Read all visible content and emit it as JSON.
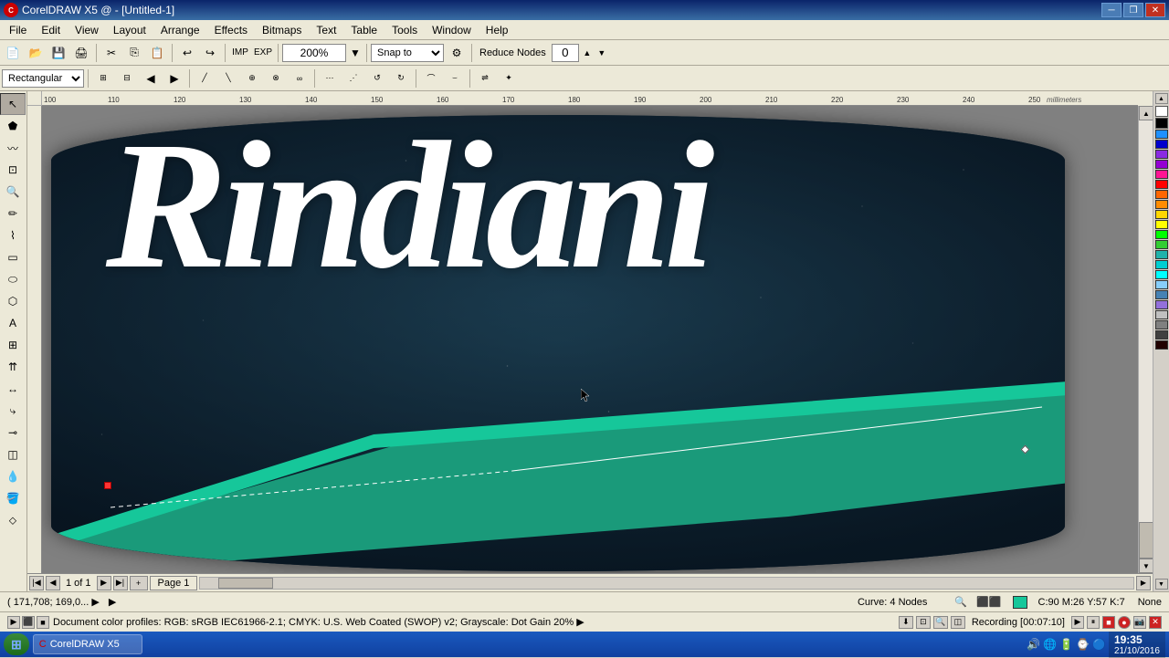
{
  "titlebar": {
    "title": "CorelDRAW X5 @ - [Untitled-1]",
    "logo": "C",
    "minimize_label": "─",
    "restore_label": "❐",
    "close_label": "✕",
    "app_min": "─",
    "app_max": "❐",
    "app_close": "✕"
  },
  "menubar": {
    "items": [
      {
        "label": "File",
        "id": "file"
      },
      {
        "label": "Edit",
        "id": "edit"
      },
      {
        "label": "View",
        "id": "view"
      },
      {
        "label": "Layout",
        "id": "layout"
      },
      {
        "label": "Arrange",
        "id": "arrange"
      },
      {
        "label": "Effects",
        "id": "effects"
      },
      {
        "label": "Bitmaps",
        "id": "bitmaps"
      },
      {
        "label": "Text",
        "id": "text"
      },
      {
        "label": "Table",
        "id": "table"
      },
      {
        "label": "Tools",
        "id": "tools"
      },
      {
        "label": "Window",
        "id": "window"
      },
      {
        "label": "Help",
        "id": "help"
      }
    ]
  },
  "toolbar": {
    "zoom_value": "200%",
    "snap_to": "Snap to",
    "reduce_nodes": "Reduce Nodes",
    "node_count": "0",
    "node_type_dropdown": "Rectangular"
  },
  "canvas": {
    "design_text": "Rindiani",
    "background_color": "#0d2030"
  },
  "statusbar": {
    "coordinates": "( 171,708; 169,0... ▶",
    "curve_info": "Curve: 4 Nodes",
    "color_info": "C:90 M:26 Y:57 K:7",
    "fill_none": "None"
  },
  "docinfo": {
    "color_profiles": "Document color profiles: RGB: sRGB IEC61966-2.1; CMYK: U.S. Web Coated (SWOP) v2; Grayscale: Dot Gain 20% ▶"
  },
  "pages": {
    "current": "1 of 1",
    "page_name": "Page 1"
  },
  "recording": {
    "label": "Recording [00:07:10]"
  },
  "taskbar": {
    "time": "19:35",
    "date": "21/10/2016"
  },
  "palette_colors": [
    "#FFFFFF",
    "#000000",
    "#FF0000",
    "#00FF00",
    "#0000FF",
    "#FFFF00",
    "#FF00FF",
    "#00FFFF",
    "#FF8000",
    "#8000FF",
    "#00FF80",
    "#FF0080",
    "#0080FF",
    "#80FF00",
    "#FF8080",
    "#8080FF",
    "#80FF80",
    "#FFFF80",
    "#808080",
    "#C0C0C0",
    "#400000",
    "#004000",
    "#000040",
    "#404000",
    "#400040",
    "#004040",
    "#804000",
    "#008040",
    "#000080",
    "#800040",
    "#2E8B57",
    "#20B2AA",
    "#1E90FF",
    "#FF6347",
    "#FFD700"
  ],
  "bottom_swatches": [
    "#16C79A",
    "#FF3399",
    "#FF6600",
    "#FF0000",
    "#808080",
    "#404040"
  ]
}
